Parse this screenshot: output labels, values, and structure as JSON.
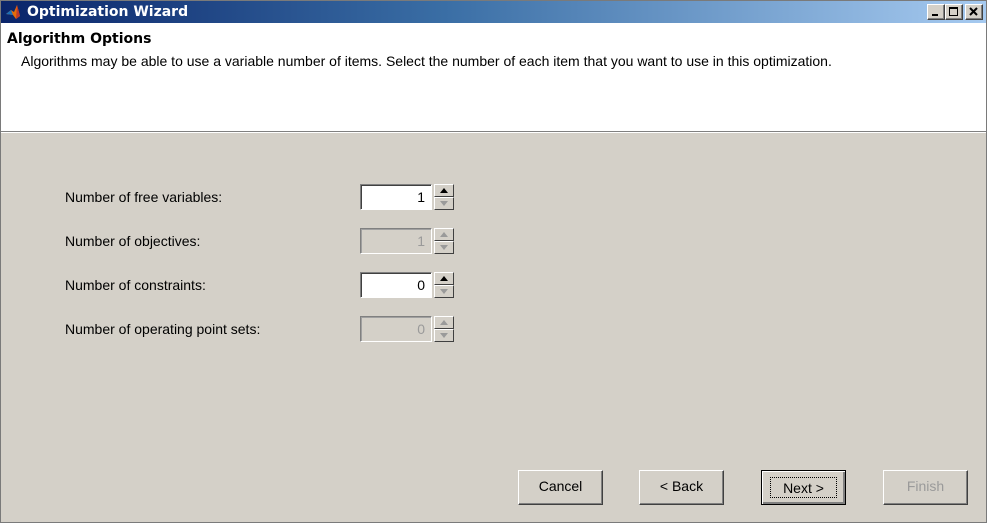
{
  "window": {
    "title": "Optimization Wizard",
    "controls": [
      "minimize-icon",
      "maximize-icon",
      "close-icon"
    ]
  },
  "header": {
    "title": "Algorithm Options",
    "description": "Algorithms may be able to use a variable number of items.  Select the number of each item that you want to use in this optimization."
  },
  "options": [
    {
      "label": "Number of free variables:",
      "value": "1",
      "enabled": true
    },
    {
      "label": "Number of objectives:",
      "value": "1",
      "enabled": false
    },
    {
      "label": "Number of constraints:",
      "value": "0",
      "enabled": true
    },
    {
      "label": "Number of operating point sets:",
      "value": "0",
      "enabled": false
    }
  ],
  "buttons": {
    "cancel": "Cancel",
    "back": "< Back",
    "next": "Next >",
    "finish": "Finish"
  },
  "colors": {
    "titlebar_start": "#0a246a",
    "titlebar_end": "#a6caf0",
    "dialog_bg": "#d4d0c8",
    "disabled_text": "#9a9a9a"
  }
}
